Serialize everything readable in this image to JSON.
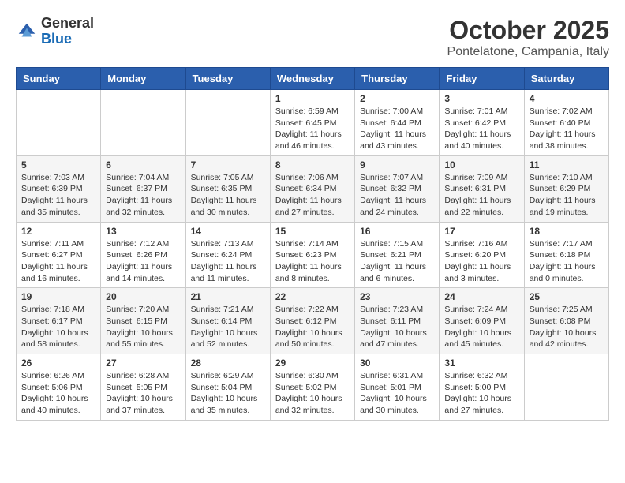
{
  "header": {
    "logo_general": "General",
    "logo_blue": "Blue",
    "month_title": "October 2025",
    "location": "Pontelatone, Campania, Italy"
  },
  "days_of_week": [
    "Sunday",
    "Monday",
    "Tuesday",
    "Wednesday",
    "Thursday",
    "Friday",
    "Saturday"
  ],
  "weeks": [
    [
      null,
      null,
      null,
      {
        "day": "1",
        "sunrise": "6:59 AM",
        "sunset": "6:45 PM",
        "daylight": "11 hours and 46 minutes."
      },
      {
        "day": "2",
        "sunrise": "7:00 AM",
        "sunset": "6:44 PM",
        "daylight": "11 hours and 43 minutes."
      },
      {
        "day": "3",
        "sunrise": "7:01 AM",
        "sunset": "6:42 PM",
        "daylight": "11 hours and 40 minutes."
      },
      {
        "day": "4",
        "sunrise": "7:02 AM",
        "sunset": "6:40 PM",
        "daylight": "11 hours and 38 minutes."
      }
    ],
    [
      {
        "day": "5",
        "sunrise": "7:03 AM",
        "sunset": "6:39 PM",
        "daylight": "11 hours and 35 minutes."
      },
      {
        "day": "6",
        "sunrise": "7:04 AM",
        "sunset": "6:37 PM",
        "daylight": "11 hours and 32 minutes."
      },
      {
        "day": "7",
        "sunrise": "7:05 AM",
        "sunset": "6:35 PM",
        "daylight": "11 hours and 30 minutes."
      },
      {
        "day": "8",
        "sunrise": "7:06 AM",
        "sunset": "6:34 PM",
        "daylight": "11 hours and 27 minutes."
      },
      {
        "day": "9",
        "sunrise": "7:07 AM",
        "sunset": "6:32 PM",
        "daylight": "11 hours and 24 minutes."
      },
      {
        "day": "10",
        "sunrise": "7:09 AM",
        "sunset": "6:31 PM",
        "daylight": "11 hours and 22 minutes."
      },
      {
        "day": "11",
        "sunrise": "7:10 AM",
        "sunset": "6:29 PM",
        "daylight": "11 hours and 19 minutes."
      }
    ],
    [
      {
        "day": "12",
        "sunrise": "7:11 AM",
        "sunset": "6:27 PM",
        "daylight": "11 hours and 16 minutes."
      },
      {
        "day": "13",
        "sunrise": "7:12 AM",
        "sunset": "6:26 PM",
        "daylight": "11 hours and 14 minutes."
      },
      {
        "day": "14",
        "sunrise": "7:13 AM",
        "sunset": "6:24 PM",
        "daylight": "11 hours and 11 minutes."
      },
      {
        "day": "15",
        "sunrise": "7:14 AM",
        "sunset": "6:23 PM",
        "daylight": "11 hours and 8 minutes."
      },
      {
        "day": "16",
        "sunrise": "7:15 AM",
        "sunset": "6:21 PM",
        "daylight": "11 hours and 6 minutes."
      },
      {
        "day": "17",
        "sunrise": "7:16 AM",
        "sunset": "6:20 PM",
        "daylight": "11 hours and 3 minutes."
      },
      {
        "day": "18",
        "sunrise": "7:17 AM",
        "sunset": "6:18 PM",
        "daylight": "11 hours and 0 minutes."
      }
    ],
    [
      {
        "day": "19",
        "sunrise": "7:18 AM",
        "sunset": "6:17 PM",
        "daylight": "10 hours and 58 minutes."
      },
      {
        "day": "20",
        "sunrise": "7:20 AM",
        "sunset": "6:15 PM",
        "daylight": "10 hours and 55 minutes."
      },
      {
        "day": "21",
        "sunrise": "7:21 AM",
        "sunset": "6:14 PM",
        "daylight": "10 hours and 52 minutes."
      },
      {
        "day": "22",
        "sunrise": "7:22 AM",
        "sunset": "6:12 PM",
        "daylight": "10 hours and 50 minutes."
      },
      {
        "day": "23",
        "sunrise": "7:23 AM",
        "sunset": "6:11 PM",
        "daylight": "10 hours and 47 minutes."
      },
      {
        "day": "24",
        "sunrise": "7:24 AM",
        "sunset": "6:09 PM",
        "daylight": "10 hours and 45 minutes."
      },
      {
        "day": "25",
        "sunrise": "7:25 AM",
        "sunset": "6:08 PM",
        "daylight": "10 hours and 42 minutes."
      }
    ],
    [
      {
        "day": "26",
        "sunrise": "6:26 AM",
        "sunset": "5:06 PM",
        "daylight": "10 hours and 40 minutes."
      },
      {
        "day": "27",
        "sunrise": "6:28 AM",
        "sunset": "5:05 PM",
        "daylight": "10 hours and 37 minutes."
      },
      {
        "day": "28",
        "sunrise": "6:29 AM",
        "sunset": "5:04 PM",
        "daylight": "10 hours and 35 minutes."
      },
      {
        "day": "29",
        "sunrise": "6:30 AM",
        "sunset": "5:02 PM",
        "daylight": "10 hours and 32 minutes."
      },
      {
        "day": "30",
        "sunrise": "6:31 AM",
        "sunset": "5:01 PM",
        "daylight": "10 hours and 30 minutes."
      },
      {
        "day": "31",
        "sunrise": "6:32 AM",
        "sunset": "5:00 PM",
        "daylight": "10 hours and 27 minutes."
      },
      null
    ]
  ],
  "labels": {
    "sunrise": "Sunrise:",
    "sunset": "Sunset:",
    "daylight": "Daylight:"
  }
}
